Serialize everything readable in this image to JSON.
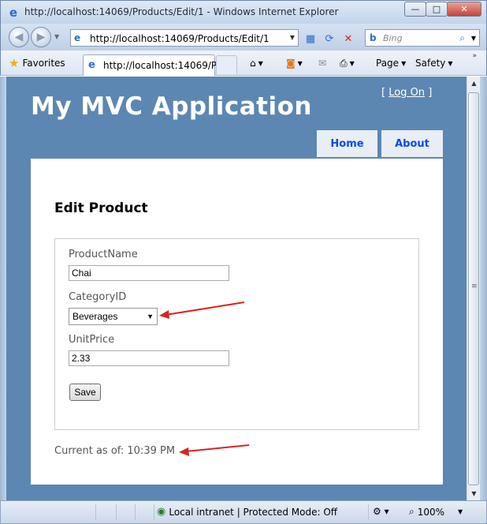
{
  "window": {
    "title": "http://localhost:14069/Products/Edit/1 - Windows Internet Explorer",
    "minimize": "—",
    "maximize": "□",
    "close": "✕"
  },
  "nav": {
    "address": "http://localhost:14069/Products/Edit/1",
    "search_placeholder": "Bing"
  },
  "favorites": {
    "label": "Favorites",
    "tab_title": "http://localhost:14069/P...",
    "page_menu": "Page",
    "safety_menu": "Safety"
  },
  "site": {
    "title": "My MVC Application",
    "logon_open": "[",
    "logon_link": "Log On",
    "logon_close": "]",
    "menu": {
      "home": "Home",
      "about": "About"
    }
  },
  "form": {
    "heading": "Edit Product",
    "product_name_label": "ProductName",
    "product_name_value": "Chai",
    "category_label": "CategoryID",
    "category_value": "Beverages",
    "unit_price_label": "UnitPrice",
    "unit_price_value": "2.33",
    "save_label": "Save"
  },
  "footer_note": "Current as of: 10:39 PM",
  "statusbar": {
    "zone": "Local intranet | Protected Mode: Off",
    "zoom": "100%"
  },
  "colors": {
    "page_background": "#5c87b2",
    "menu_link": "#034af3",
    "annotation_arrow": "#e0201d"
  }
}
